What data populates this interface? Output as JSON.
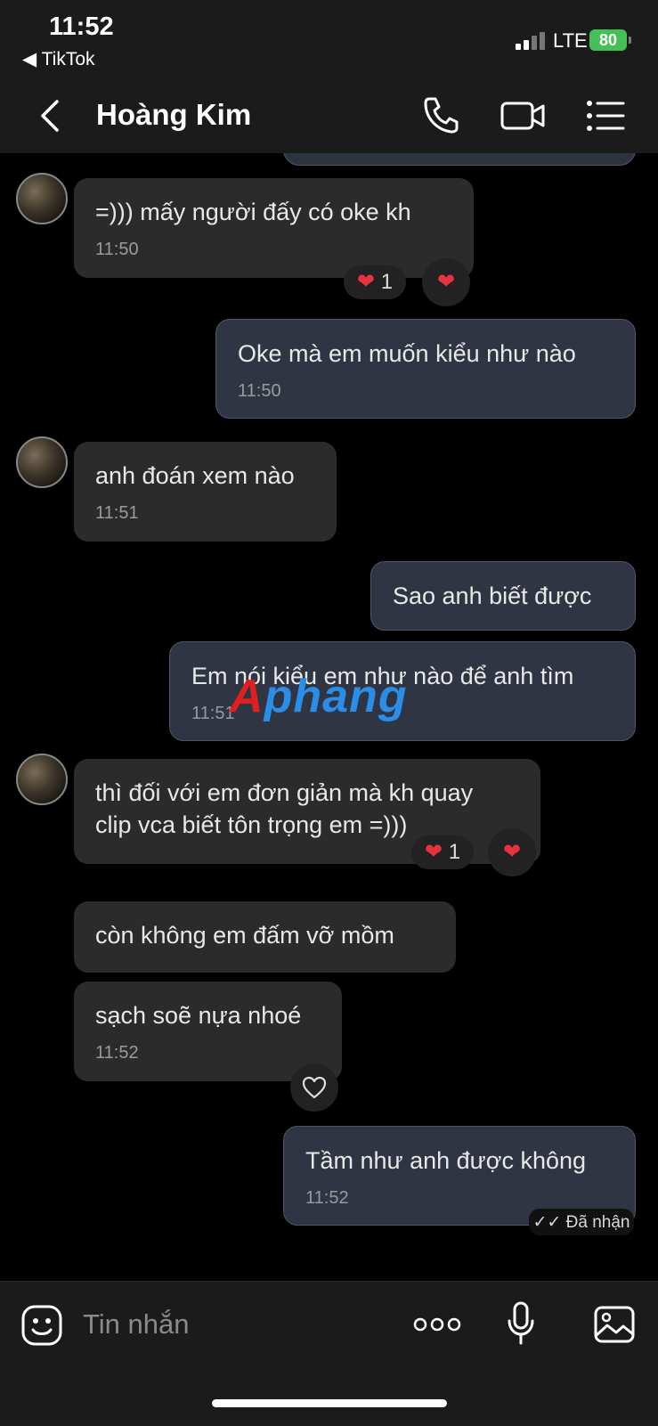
{
  "status_bar": {
    "time": "11:52",
    "back_app": "◀ TikTok",
    "network": "LTE",
    "battery": "80"
  },
  "header": {
    "contact_name": "Hoàng Kim",
    "icons": [
      "back-icon",
      "phone-icon",
      "video-call-icon",
      "menu-list-icon"
    ]
  },
  "messages": [
    {
      "direction": "in",
      "text": "=))) mấy người đấy có oke kh",
      "time": "11:50",
      "reaction_count": "1"
    },
    {
      "direction": "out",
      "text": "Oke mà em muốn kiểu như nào",
      "time": "11:50"
    },
    {
      "direction": "in",
      "text": "anh đoán xem nào",
      "time": "11:51"
    },
    {
      "direction": "out",
      "text": "Sao anh biết được"
    },
    {
      "direction": "out",
      "text": "Em nói kiểu em như nào để anh tìm",
      "time": "11:51"
    },
    {
      "direction": "in",
      "text": "thì đối với em đơn giản mà kh quay\nclip vca biết tôn trọng em =)))",
      "reaction_count": "1"
    },
    {
      "direction": "in",
      "text": "còn không em đấm vỡ mồm"
    },
    {
      "direction": "in",
      "text": "sạch soẽ nựa nhoé",
      "time": "11:52"
    },
    {
      "direction": "out",
      "text": "Tầm như anh được không",
      "time": "11:52"
    }
  ],
  "delivery_status": "✓✓ Đã nhận",
  "watermark": {
    "part1": "A",
    "part2": "phang"
  },
  "composer": {
    "placeholder": "Tin nhắn",
    "icons": [
      "sticker-icon",
      "more-icon",
      "microphone-icon",
      "image-icon"
    ]
  },
  "colors": {
    "heart": "#e8323d",
    "battery": "#45c057",
    "incoming_bubble": "#2b2b2b",
    "outgoing_bubble": "#2f3542"
  }
}
